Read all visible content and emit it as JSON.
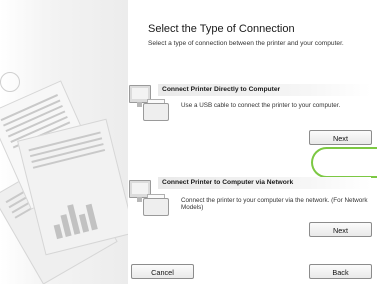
{
  "header": {
    "title": "Select the Type of Connection",
    "subtitle": "Select a type of connection between the printer and your computer."
  },
  "options": [
    {
      "title": "Connect Printer Directly to Computer",
      "description": "Use a USB cable to connect the printer to your computer.",
      "button_label": "Next"
    },
    {
      "title": "Connect Printer to Computer via Network",
      "description": "Connect the printer to your computer via the network. (For Network Models)",
      "button_label": "Next"
    }
  ],
  "footer": {
    "cancel_label": "Cancel",
    "back_label": "Back"
  },
  "colors": {
    "highlight": "#7cc843"
  }
}
